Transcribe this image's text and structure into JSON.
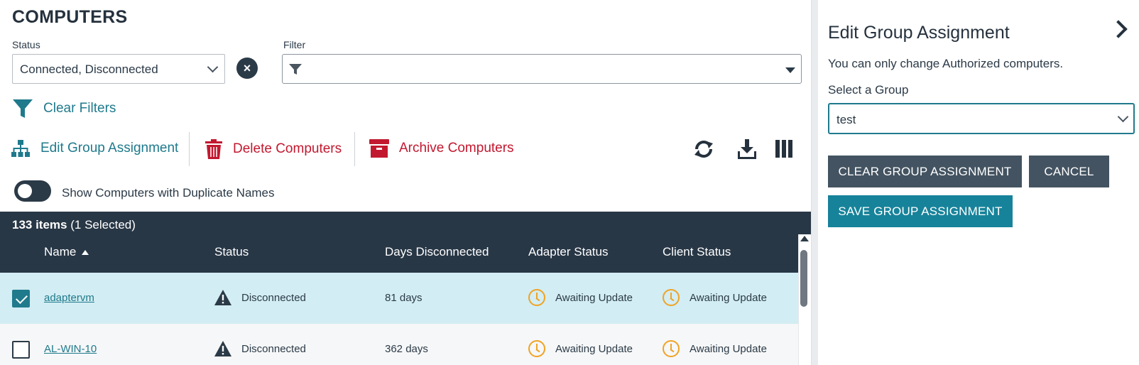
{
  "page": {
    "title": "COMPUTERS"
  },
  "filters": {
    "status_label": "Status",
    "status_value": "Connected, Disconnected",
    "filter_label": "Filter",
    "filter_value": "",
    "clear_filters": "Clear Filters"
  },
  "toolbar": {
    "edit_group": "Edit Group Assignment",
    "delete": "Delete Computers",
    "archive": "Archive Computers"
  },
  "duplicate_toggle": {
    "label": "Show Computers with Duplicate Names",
    "on": false
  },
  "grid": {
    "count": "133 items",
    "selected": "(1 Selected)",
    "columns": [
      "Name",
      "Status",
      "Days Disconnected",
      "Adapter Status",
      "Client Status"
    ],
    "rows": [
      {
        "name": "adaptervm",
        "status": "Disconnected",
        "days": "81 days",
        "adapter": "Awaiting Update",
        "client": "Awaiting Update",
        "selected": true
      },
      {
        "name": "AL-WIN-10",
        "status": "Disconnected",
        "days": "362 days",
        "adapter": "Awaiting Update",
        "client": "Awaiting Update",
        "selected": false
      }
    ]
  },
  "panel": {
    "title": "Edit Group Assignment",
    "note": "You can only change Authorized computers.",
    "select_label": "Select a Group",
    "select_value": "test",
    "clear_btn": "CLEAR GROUP ASSIGNMENT",
    "cancel_btn": "CANCEL",
    "save_btn": "SAVE GROUP ASSIGNMENT"
  },
  "colors": {
    "teal": "#1f7a8c",
    "red": "#c2182f",
    "header": "#283746",
    "selected_row": "#d2edf3",
    "awaiting": "#f0a324"
  }
}
